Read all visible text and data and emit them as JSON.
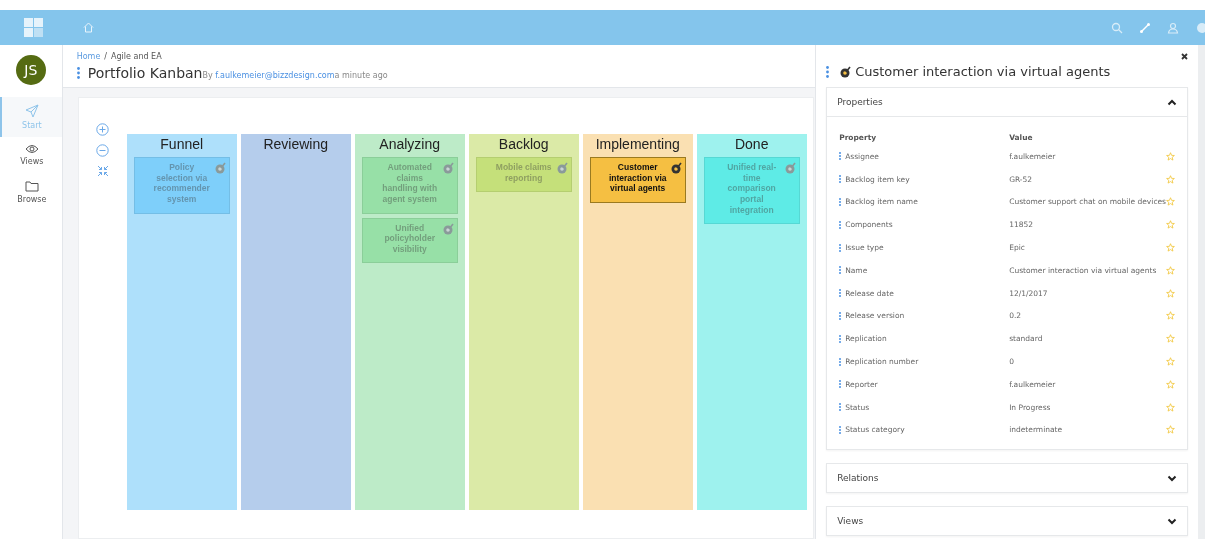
{
  "user": {
    "initials": "JS"
  },
  "sidebar": {
    "items": [
      {
        "label": "Start",
        "selected": true,
        "kind": "send"
      },
      {
        "label": "Views",
        "selected": false,
        "kind": "eye"
      },
      {
        "label": "Browse",
        "selected": false,
        "kind": "folder"
      }
    ]
  },
  "breadcrumb": [
    {
      "label": "Home",
      "kind": "link"
    },
    {
      "label": "/",
      "kind": "separator"
    },
    {
      "label": "Agile and EA",
      "kind": "current"
    }
  ],
  "page": {
    "title": "Portfolio Kanban",
    "by": "By",
    "author": "f.aulkemeier@bizzdesign.com",
    "time": "a minute ago"
  },
  "board": {
    "columns": [
      {
        "title": "Funnel",
        "color": "#aee0fb",
        "cards": [
          {
            "title": "Policy selection via recommender system",
            "selected": false,
            "color": "#7ecffa"
          }
        ]
      },
      {
        "title": "Reviewing",
        "color": "#b5cdec"
      },
      {
        "title": "Analyzing",
        "color": "#bdebc8",
        "cards": [
          {
            "title": "Automated claims handling with agent system",
            "selected": false,
            "color": "#97e0a7"
          },
          {
            "title": "Unified policyholder visibility",
            "selected": false,
            "color": "#97e0a7"
          }
        ]
      },
      {
        "title": "Backlog",
        "color": "#dbeaa7",
        "cards": [
          {
            "title": "Mobile claims reporting",
            "selected": false,
            "color": "#c5e07a"
          }
        ]
      },
      {
        "title": "Implementing",
        "color": "#fae0b2",
        "cards": [
          {
            "title": "Customer interaction via virtual agents",
            "selected": true,
            "color": "#f5bf42"
          }
        ]
      },
      {
        "title": "Done",
        "color": "#9ef2ee",
        "cards": [
          {
            "title": "Unified real-time comparison portal integration",
            "selected": false,
            "color": "#5eebe6"
          }
        ]
      }
    ]
  },
  "detail": {
    "title": "Customer interaction via virtual agents",
    "sections": [
      {
        "title": "Properties",
        "expanded": true,
        "columns": [
          "Property",
          "Value"
        ],
        "rows": [
          {
            "property": "Assignee",
            "value": "f.aulkemeier"
          },
          {
            "property": "Backlog item key",
            "value": "GR-52"
          },
          {
            "property": "Backlog item name",
            "value": "Customer support chat on mobile devices"
          },
          {
            "property": "Components",
            "value": "11852"
          },
          {
            "property": "Issue type",
            "value": "Epic"
          },
          {
            "property": "Name",
            "value": "Customer interaction via virtual agents"
          },
          {
            "property": "Release date",
            "value": "12/1/2017"
          },
          {
            "property": "Release version",
            "value": "0.2"
          },
          {
            "property": "Replication",
            "value": "standard"
          },
          {
            "property": "Replication number",
            "value": "0"
          },
          {
            "property": "Reporter",
            "value": "f.aulkemeier"
          },
          {
            "property": "Status",
            "value": "In Progress"
          },
          {
            "property": "Status category",
            "value": "indeterminate"
          }
        ]
      },
      {
        "title": "Relations",
        "expanded": false
      },
      {
        "title": "Views",
        "expanded": false
      }
    ]
  }
}
